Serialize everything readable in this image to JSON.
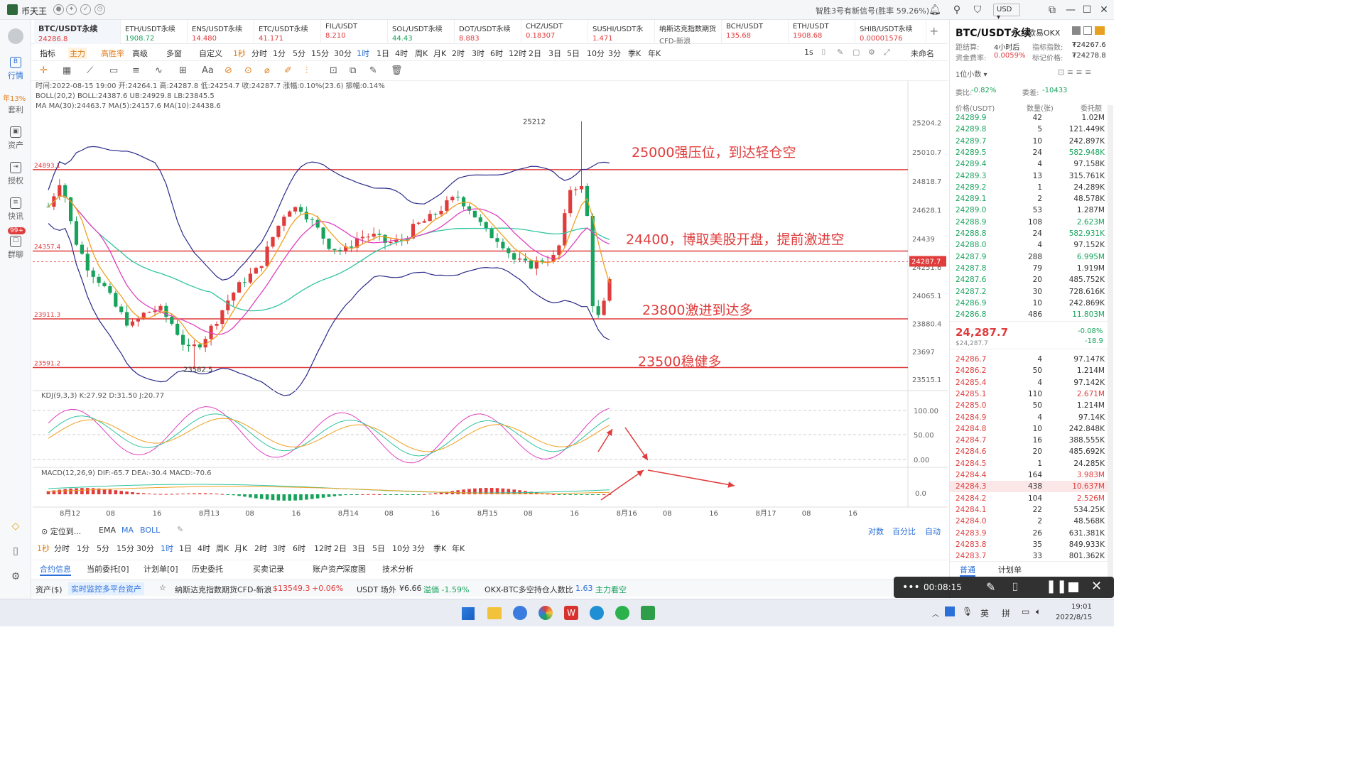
{
  "title_bar": {
    "app_name": "币天王",
    "notice": "智胜3号有新信号(胜率 59.26%)",
    "currency": "USD"
  },
  "left_nav": [
    {
      "label": "行情"
    },
    {
      "label": "套利",
      "badge": "年13%"
    },
    {
      "label": "资产"
    },
    {
      "label": "授权"
    },
    {
      "label": "快讯"
    },
    {
      "label": "群聊",
      "badge": "99+"
    }
  ],
  "tabs": [
    {
      "name": "BTC/USDT永续",
      "price": "24286.8",
      "color": "#e03c3c"
    },
    {
      "name": "ETH/USDT永续",
      "price": "1908.72",
      "color": "#17a35c"
    },
    {
      "name": "ENS/USDT永续",
      "price": "14.480",
      "color": "#e03c3c"
    },
    {
      "name": "ETC/USDT永续",
      "price": "41.171",
      "color": "#e03c3c"
    },
    {
      "name": "FIL/USDT",
      "price": "8.210",
      "color": "#e03c3c"
    },
    {
      "name": "SOL/USDT永续",
      "price": "44.43",
      "color": "#17a35c"
    },
    {
      "name": "DOT/USDT永续",
      "price": "8.883",
      "color": "#e03c3c"
    },
    {
      "name": "CHZ/USDT",
      "price": "0.18307",
      "color": "#e03c3c"
    },
    {
      "name": "SUSHI/USDT永",
      "price": "1.471",
      "color": "#e03c3c"
    },
    {
      "name": "纳斯达克指数期货",
      "price": "CFD-新浪",
      "color": "#666666"
    },
    {
      "name": "BCH/USDT",
      "price": "135.68",
      "color": "#e03c3c"
    },
    {
      "name": "ETH/USDT",
      "price": "1908.68",
      "color": "#e03c3c"
    },
    {
      "name": "SHIB/USDT永续",
      "price": "0.00001576",
      "color": "#e03c3c"
    }
  ],
  "toolbar": {
    "items": [
      "指标",
      "主力",
      "高胜率",
      "高级",
      "多窗",
      "自定义",
      "1秒",
      "分时",
      "1分",
      "5分",
      "15分",
      "30分",
      "1时",
      "1日",
      "4时",
      "周K",
      "月K",
      "2时",
      "3时",
      "6时",
      "12时",
      "2日",
      "3日",
      "5日",
      "10分",
      "3分",
      "季K",
      "年K"
    ],
    "right": [
      "1s",
      "未命名"
    ]
  },
  "chart_header": {
    "line1": "时间:2022-08-15 19:00  开:24264.1  高:24287.8  低:24254.7  收:24287.7  涨幅:0.10%(23.6)  振幅:0.14%",
    "boll": "BOLL(20,2)  BOLL:24387.6  UB:24929.8  LB:23845.5",
    "ma": "MA  MA(30):24463.7  MA(5):24157.6  MA(10):24438.6",
    "kdj": "KDJ(9,3,3)  K:27.92  D:31.50  J:20.77",
    "macd": "MACD(12,26,9)  DIF:-65.7  DEA:-30.4  MACD:-70.6"
  },
  "chart_data": {
    "type": "candlestick",
    "symbol": "BTC/USDT永续",
    "interval": "1时",
    "price_axis": {
      "ticks": [
        25204.2,
        25010.7,
        24818.7,
        24628.1,
        24439.0,
        24251.6,
        24065.1,
        23880.4,
        23697.0,
        23515.1
      ],
      "last_price": "24287.7"
    },
    "x_ticks": [
      "8月12",
      "08",
      "16",
      "8月13",
      "08",
      "16",
      "8月14",
      "08",
      "16",
      "8月15",
      "08",
      "16",
      "8月16",
      "08",
      "16",
      "8月17",
      "08",
      "16"
    ],
    "kdj_ticks": [
      "100.00",
      "50.00",
      "0.00"
    ],
    "macd_ticks": [
      "0.0"
    ],
    "extreme_labels": {
      "high": "25212",
      "low": "23582.5"
    },
    "levels": [
      {
        "price": 24893.1,
        "label": "24893.1",
        "note": "25000强压位，到达轻仓空"
      },
      {
        "price": 24357.4,
        "label": "24357.4",
        "note": "24400，博取美股开盘，提前激进空"
      },
      {
        "price": 23911.3,
        "label": "23911.3",
        "note": "23800激进到达多"
      },
      {
        "price": 23591.2,
        "label": "23591.2",
        "note": "23500稳健多"
      }
    ],
    "ylim": [
      23400,
      25300
    ]
  },
  "bottom_bar": {
    "locate": "定位到...",
    "indicators": [
      "EMA",
      "MA",
      "BOLL"
    ],
    "modes": [
      "对数",
      "百分比",
      "自动"
    ],
    "intervals": [
      "1秒",
      "分时",
      "1分",
      "5分",
      "15分",
      "30分",
      "1时",
      "1日",
      "4时",
      "周K",
      "月K",
      "2时",
      "3时",
      "6时",
      "12时",
      "2日",
      "3日",
      "5日",
      "10分",
      "3分",
      "季K",
      "年K"
    ],
    "tabs": [
      "合约信息",
      "当前委托[0]",
      "计划单[0]",
      "历史委托",
      "买卖记录",
      "账户资产",
      "深度图",
      "技术分析"
    ]
  },
  "status_bar": {
    "asset": "资产($)",
    "monitor": "实时监控多平台资产",
    "nasdaq": "纳斯达克指数期货CFD-新浪",
    "nasdaq_price": "$13549.3",
    "nasdaq_chg": "+0.06%",
    "usdt": "USDT 场外",
    "usdt_val": "¥6.66",
    "premium": "溢価 -1.59%",
    "okx": "OKX-BTC多空持仓人数比",
    "okx_val": "1.63",
    "okx_note": "主力看空"
  },
  "right_panel": {
    "symbol": "BTC/USDT永续",
    "exchange": "欧易OKX",
    "settle_label": "距结算:",
    "settle_val": "4小时后",
    "index_label": "指标指数:",
    "index_val": "₮24267.6",
    "rate_label": "资金费率:",
    "rate_val": "0.0059%",
    "mark_label": "标记价格:",
    "mark_val": "₮24278.8",
    "decimal": "1位小数",
    "ratio_label": "委比:",
    "ratio_val": "-0.82%",
    "diff_label": "委差:",
    "diff_val": "-10433",
    "cols": [
      "价格(USDT)",
      "数量(张)",
      "委托额"
    ],
    "asks": [
      [
        "24289.9",
        "42",
        "1.02M"
      ],
      [
        "24289.8",
        "5",
        "121.449K"
      ],
      [
        "24289.7",
        "10",
        "242.897K"
      ],
      [
        "24289.5",
        "24",
        "582.948K"
      ],
      [
        "24289.4",
        "4",
        "97.158K"
      ],
      [
        "24289.3",
        "13",
        "315.761K"
      ],
      [
        "24289.2",
        "1",
        "24.289K"
      ],
      [
        "24289.1",
        "2",
        "48.578K"
      ],
      [
        "24289.0",
        "53",
        "1.287M"
      ],
      [
        "24288.9",
        "108",
        "2.623M"
      ],
      [
        "24288.8",
        "24",
        "582.931K"
      ],
      [
        "24288.0",
        "4",
        "97.152K"
      ],
      [
        "24287.9",
        "288",
        "6.995M"
      ],
      [
        "24287.8",
        "79",
        "1.919M"
      ],
      [
        "24287.6",
        "20",
        "485.752K"
      ],
      [
        "24287.2",
        "30",
        "728.616K"
      ],
      [
        "24286.9",
        "10",
        "242.869K"
      ],
      [
        "24286.8",
        "486",
        "11.803M"
      ]
    ],
    "last_price": "24,287.7",
    "last_sub": "$24,287.7",
    "change_pct": "-0.08%",
    "change_abs": "-18.9",
    "bids": [
      [
        "24286.7",
        "4",
        "97.147K"
      ],
      [
        "24286.2",
        "50",
        "1.214M"
      ],
      [
        "24285.4",
        "4",
        "97.142K"
      ],
      [
        "24285.1",
        "110",
        "2.671M"
      ],
      [
        "24285.0",
        "50",
        "1.214M"
      ],
      [
        "24284.9",
        "4",
        "97.14K"
      ],
      [
        "24284.8",
        "10",
        "242.848K"
      ],
      [
        "24284.7",
        "16",
        "388.555K"
      ],
      [
        "24284.6",
        "20",
        "485.692K"
      ],
      [
        "24284.5",
        "1",
        "24.285K"
      ],
      [
        "24284.4",
        "164",
        "3.983M"
      ],
      [
        "24284.3",
        "438",
        "10.637M"
      ],
      [
        "24284.2",
        "104",
        "2.526M"
      ],
      [
        "24284.1",
        "22",
        "534.25K"
      ],
      [
        "24284.0",
        "2",
        "48.568K"
      ],
      [
        "24283.9",
        "26",
        "631.381K"
      ],
      [
        "24283.8",
        "35",
        "849.933K"
      ],
      [
        "24283.7",
        "33",
        "801.362K"
      ]
    ],
    "bottom_tabs": [
      "普通",
      "计划单"
    ]
  },
  "video_overlay": {
    "time": "00:08:15"
  },
  "taskbar": {
    "ime1": "英",
    "ime2": "拼",
    "time": "19:01",
    "date": "2022/8/15"
  }
}
